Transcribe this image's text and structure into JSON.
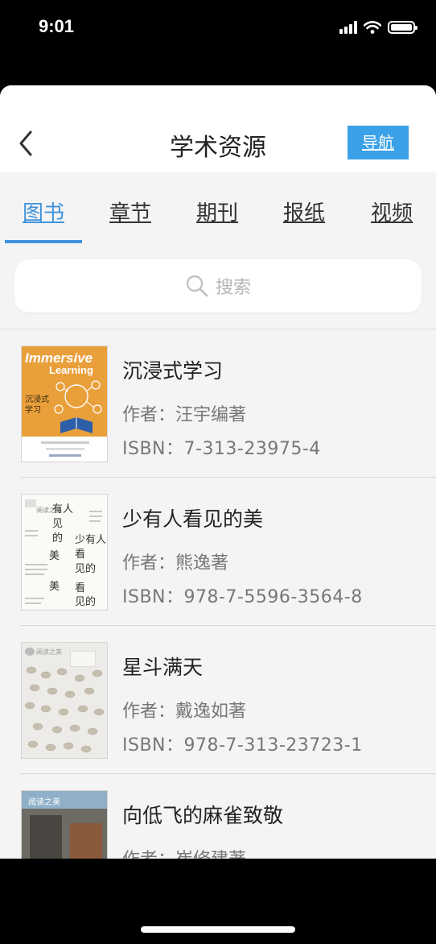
{
  "status_bar": {
    "time": "9:01"
  },
  "header": {
    "title": "学术资源",
    "nav_label": "导航"
  },
  "tabs": [
    {
      "label": "图书",
      "active": true
    },
    {
      "label": "章节",
      "active": false
    },
    {
      "label": "期刊",
      "active": false
    },
    {
      "label": "报纸",
      "active": false
    },
    {
      "label": "视频",
      "active": false
    }
  ],
  "search": {
    "placeholder": "搜索"
  },
  "books": [
    {
      "title": "沉浸式学习",
      "author": "作者：汪宇编著",
      "isbn": "ISBN：7-313-23975-4",
      "cover": {
        "line1": "Immersive",
        "line2": "Learning",
        "cn": "沉浸式学习"
      }
    },
    {
      "title": "少有人看见的美",
      "author": "作者：熊逸著",
      "isbn": "ISBN：978-7-5596-3564-8",
      "cover": {
        "series": "阅读之美"
      }
    },
    {
      "title": "星斗满天",
      "author": "作者：戴逸如著",
      "isbn": "ISBN：978-7-313-23723-1",
      "cover": {
        "series": "阅读之美"
      }
    },
    {
      "title": "向低飞的麻雀致敬",
      "author": "作者：崔修建著",
      "isbn": "",
      "cover": {
        "series": "阅读之美"
      }
    }
  ],
  "colors": {
    "accent": "#3f93dc",
    "nav_button": "#3aa1e8"
  }
}
